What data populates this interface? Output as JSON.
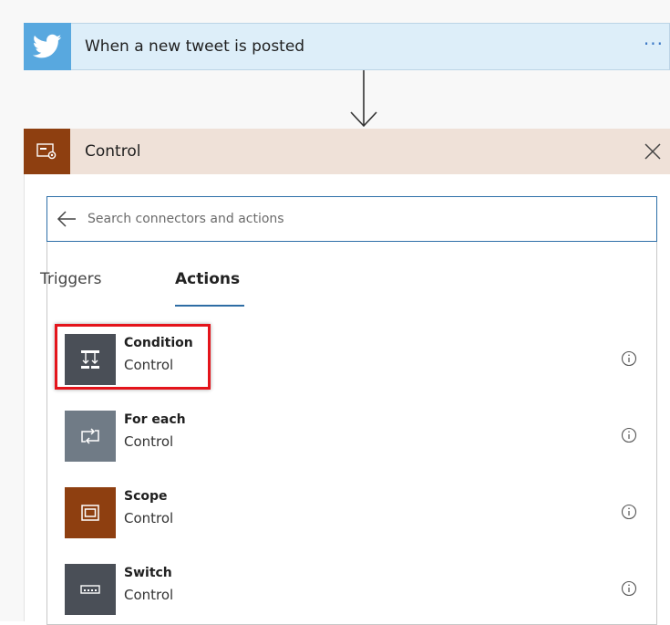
{
  "trigger": {
    "title": "When a new tweet is posted",
    "more_label": "···",
    "icon": "twitter-bird-icon",
    "color": "#58a8df"
  },
  "control": {
    "title": "Control",
    "icon": "control-icon",
    "color": "#8e3f10"
  },
  "search": {
    "placeholder": "Search connectors and actions",
    "value": ""
  },
  "tabs": [
    {
      "label": "Triggers",
      "selected": false
    },
    {
      "label": "Actions",
      "selected": true
    }
  ],
  "actions": [
    {
      "name": "Condition",
      "connector": "Control",
      "icon": "condition-icon",
      "color": "#4a4f57",
      "highlighted": true
    },
    {
      "name": "For each",
      "connector": "Control",
      "icon": "loop-icon",
      "color": "#707b86",
      "highlighted": false
    },
    {
      "name": "Scope",
      "connector": "Control",
      "icon": "scope-icon",
      "color": "#8e3f10",
      "highlighted": false
    },
    {
      "name": "Switch",
      "connector": "Control",
      "icon": "switch-icon",
      "color": "#4a4f57",
      "highlighted": false
    }
  ],
  "highlight_color": "#e4141b"
}
